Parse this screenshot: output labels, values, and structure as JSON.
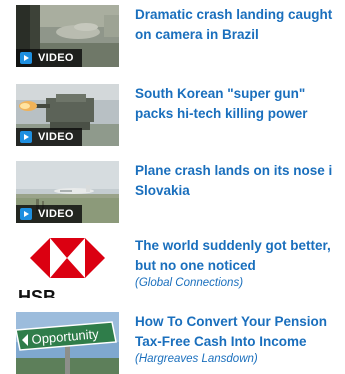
{
  "video_badge_label": "VIDEO",
  "colors": {
    "headline": "#1a6fbd",
    "badge_bg": "#0c0c0c",
    "play_icon": "#1e8fe0",
    "hsbc_red": "#db0011"
  },
  "items": [
    {
      "headline_line1": "Dramatic crash landing caught",
      "headline_line2": "on camera in Brazil",
      "is_video": true,
      "thumbnail": "crash-landing-video-thumbnail"
    },
    {
      "headline_line1": "South Korean \"super gun\"",
      "headline_line2": "packs hi-tech killing power",
      "is_video": true,
      "thumbnail": "super-gun-video-thumbnail"
    },
    {
      "headline_line1": "Plane crash lands on its nose i",
      "headline_line2": "Slovakia",
      "is_video": true,
      "thumbnail": "plane-nose-landing-video-thumbnail"
    },
    {
      "headline_line1": "The world suddenly got better,",
      "headline_line2": "but no one noticed",
      "source": "(Global Connections)",
      "is_video": false,
      "thumbnail": "hsbc-logo-thumbnail",
      "thumbnail_text": "HSB"
    },
    {
      "headline_line1": "How To Convert Your Pension",
      "headline_line2": "Tax-Free Cash Into Income",
      "source": "(Hargreaves Lansdown)",
      "is_video": false,
      "thumbnail": "opportunity-sign-thumbnail",
      "thumbnail_text": "Opportunity"
    }
  ]
}
